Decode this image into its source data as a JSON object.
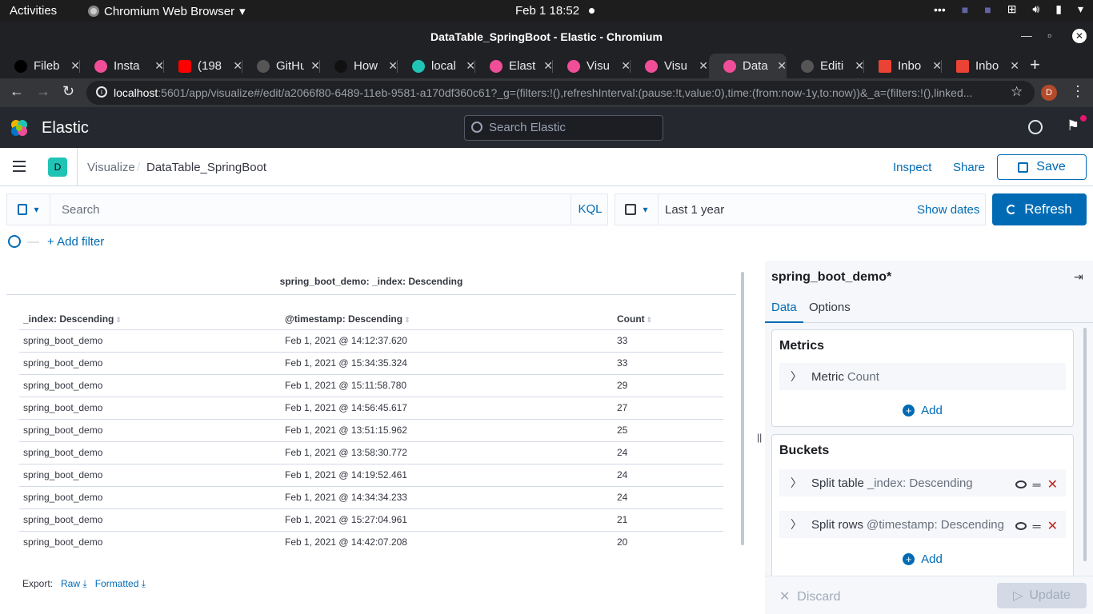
{
  "os": {
    "activities": "Activities",
    "app_name": "Chromium Web Browser",
    "clock": "Feb 1  18:52"
  },
  "window": {
    "title": "DataTable_SpringBoot - Elastic - Chromium"
  },
  "tabs": [
    {
      "label": "Fileb",
      "color": "#000000"
    },
    {
      "label": "Insta",
      "color": "#f04e98"
    },
    {
      "label": "(198",
      "color": "#ff0000"
    },
    {
      "label": "GitHu",
      "color": "#24292e"
    },
    {
      "label": "How",
      "color": "#333333"
    },
    {
      "label": "local",
      "color": "#20c4b5"
    },
    {
      "label": "Elast",
      "color": "#f04e98"
    },
    {
      "label": "Visu",
      "color": "#f04e98"
    },
    {
      "label": "Visu",
      "color": "#f04e98"
    },
    {
      "label": "Data",
      "color": "#f04e98"
    },
    {
      "label": "Editi",
      "color": "#24292e"
    },
    {
      "label": "Inbo",
      "color": "#ea4335"
    },
    {
      "label": "Inbo",
      "color": "#ea4335"
    }
  ],
  "address": {
    "host": "localhost",
    "rest": ":5601/app/visualize#/edit/a2066f80-6489-11eb-9581-a170df360c61?_g=(filters:!(),refreshInterval:(pause:!t,value:0),time:(from:now-1y,to:now))&_a=(filters:!(),linked...",
    "profile_initial": "D"
  },
  "kibana": {
    "brand": "Elastic",
    "search_placeholder": "Search Elastic"
  },
  "breadcrumb": {
    "space": "D",
    "parent": "Visualize",
    "current": "DataTable_SpringBoot",
    "inspect": "Inspect",
    "share": "Share",
    "save": "Save"
  },
  "query": {
    "placeholder": "Search",
    "language": "KQL",
    "time_range": "Last 1 year",
    "show_dates": "Show dates",
    "refresh": "Refresh",
    "add_filter": "+ Add filter"
  },
  "table": {
    "title": "spring_boot_demo: _index: Descending",
    "columns": [
      "_index: Descending",
      "@timestamp: Descending",
      "Count"
    ],
    "rows": [
      [
        "spring_boot_demo",
        "Feb 1, 2021 @ 14:12:37.620",
        "33"
      ],
      [
        "spring_boot_demo",
        "Feb 1, 2021 @ 15:34:35.324",
        "33"
      ],
      [
        "spring_boot_demo",
        "Feb 1, 2021 @ 15:11:58.780",
        "29"
      ],
      [
        "spring_boot_demo",
        "Feb 1, 2021 @ 14:56:45.617",
        "27"
      ],
      [
        "spring_boot_demo",
        "Feb 1, 2021 @ 13:51:15.962",
        "25"
      ],
      [
        "spring_boot_demo",
        "Feb 1, 2021 @ 13:58:30.772",
        "24"
      ],
      [
        "spring_boot_demo",
        "Feb 1, 2021 @ 14:19:52.461",
        "24"
      ],
      [
        "spring_boot_demo",
        "Feb 1, 2021 @ 14:34:34.233",
        "24"
      ],
      [
        "spring_boot_demo",
        "Feb 1, 2021 @ 15:27:04.961",
        "21"
      ],
      [
        "spring_boot_demo",
        "Feb 1, 2021 @ 14:42:07.208",
        "20"
      ]
    ],
    "export_label": "Export:",
    "export_raw": "Raw",
    "export_formatted": "Formatted"
  },
  "sidebar": {
    "index_pattern": "spring_boot_demo*",
    "tab_data": "Data",
    "tab_options": "Options",
    "metrics_title": "Metrics",
    "metric_label": "Metric",
    "metric_value": "Count",
    "add": "Add",
    "buckets_title": "Buckets",
    "bucket1_label": "Split table",
    "bucket1_value": "_index: Descending",
    "bucket2_label": "Split rows",
    "bucket2_value": "@timestamp: Descending",
    "discard": "Discard",
    "update": "Update"
  },
  "colors": {
    "accent": "#006bb4",
    "header_bg": "#25282f",
    "danger": "#bd271e"
  }
}
